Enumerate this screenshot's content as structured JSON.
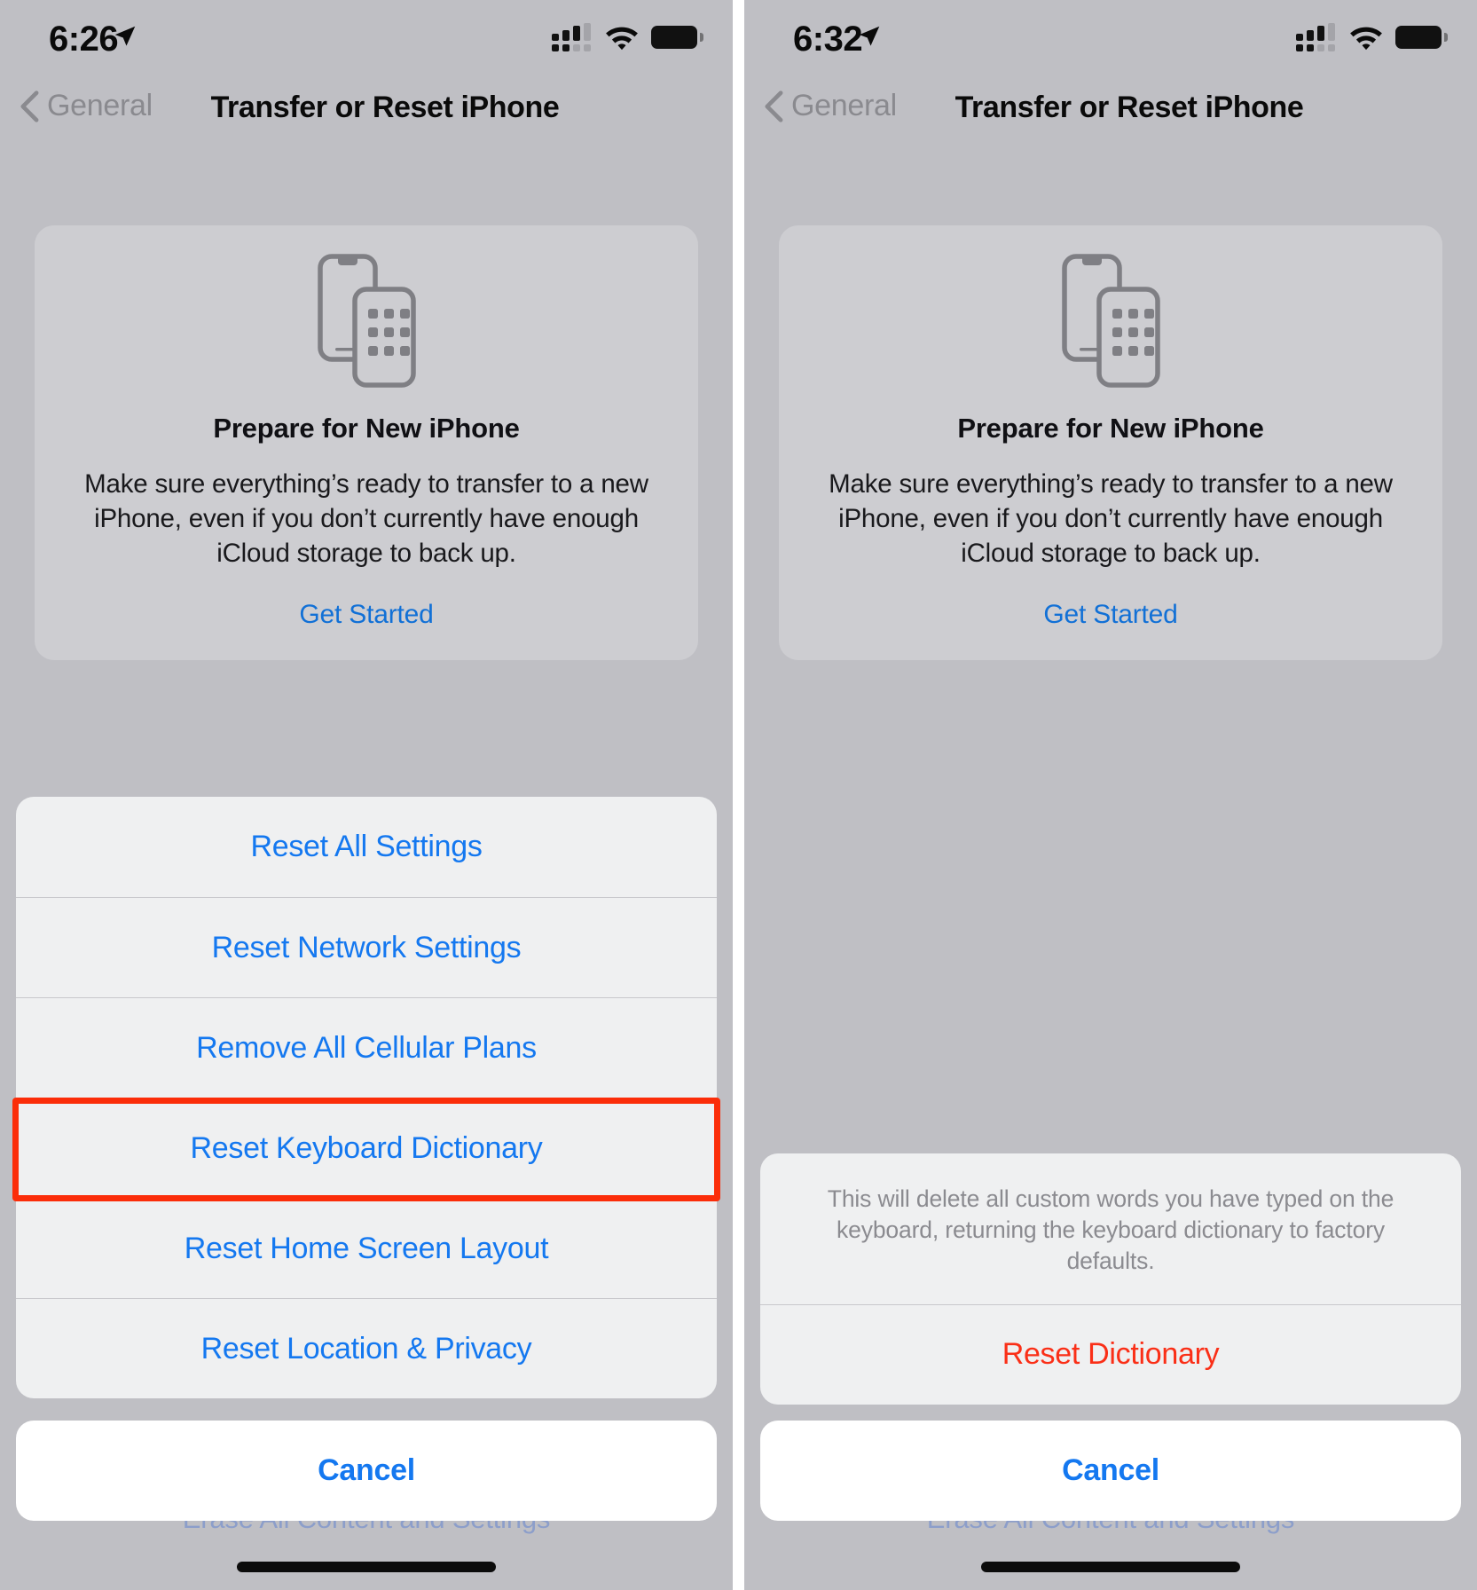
{
  "colors": {
    "background": "#bfbfc4",
    "card": "#cdcdd1",
    "sheet": "#eff0f1",
    "link_blue": "#1478f0",
    "destructive_red": "#fa2f17",
    "highlight_red": "#fb2d09",
    "cancel_background": "#ffffff"
  },
  "panels": [
    {
      "status": {
        "time": "6:26",
        "location_icon": "location-arrow-icon",
        "cellular_icon": "cellular-signal-icon",
        "wifi_icon": "wifi-icon",
        "battery_icon": "battery-icon"
      },
      "nav": {
        "back_icon": "chevron-left-icon",
        "back_label": "General",
        "title": "Transfer or Reset iPhone"
      },
      "prepare_card": {
        "icon": "two-phones-icon",
        "title": "Prepare for New iPhone",
        "body": "Make sure everything’s ready to transfer to a new iPhone, even if you don’t currently have enough iCloud storage to back up.",
        "link": "Get Started"
      },
      "underlay_row": "Erase All Content and Settings",
      "sheet": {
        "message": "",
        "rows": [
          {
            "label": "Reset All Settings",
            "style": "default"
          },
          {
            "label": "Reset Network Settings",
            "style": "default"
          },
          {
            "label": "Remove All Cellular Plans",
            "style": "default"
          },
          {
            "label": "Reset Keyboard Dictionary",
            "style": "default"
          },
          {
            "label": "Reset Home Screen Layout",
            "style": "default"
          },
          {
            "label": "Reset Location & Privacy",
            "style": "default"
          }
        ]
      },
      "cancel_label": "Cancel",
      "highlight": {
        "target": "Reset Keyboard Dictionary"
      }
    },
    {
      "status": {
        "time": "6:32",
        "location_icon": "location-arrow-icon",
        "cellular_icon": "cellular-signal-icon",
        "wifi_icon": "wifi-icon",
        "battery_icon": "battery-icon"
      },
      "nav": {
        "back_icon": "chevron-left-icon",
        "back_label": "General",
        "title": "Transfer or Reset iPhone"
      },
      "prepare_card": {
        "icon": "two-phones-icon",
        "title": "Prepare for New iPhone",
        "body": "Make sure everything’s ready to transfer to a new iPhone, even if you don’t currently have enough iCloud storage to back up.",
        "link": "Get Started"
      },
      "underlay_row": "Erase All Content and Settings",
      "sheet": {
        "message": "This will delete all custom words you have typed on the keyboard, returning the keyboard dictionary to factory defaults.",
        "rows": [
          {
            "label": "Reset Dictionary",
            "style": "destructive"
          }
        ]
      },
      "cancel_label": "Cancel",
      "highlight": null
    }
  ]
}
